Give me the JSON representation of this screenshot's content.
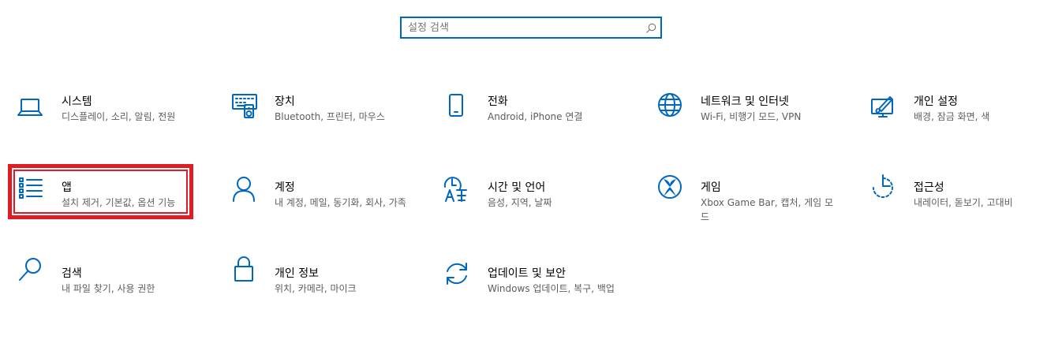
{
  "search": {
    "placeholder": "설정 검색"
  },
  "colors": {
    "accent": "#0067c0",
    "highlight_border": "#e01b24",
    "description": "#5d5d5d"
  },
  "tiles": [
    {
      "title": "시스템",
      "desc": "디스플레이, 소리, 알림, 전원",
      "icon": "laptop-icon"
    },
    {
      "title": "장치",
      "desc": "Bluetooth, 프린터, 마우스",
      "icon": "keyboard-speaker-icon"
    },
    {
      "title": "전화",
      "desc": "Android, iPhone 연결",
      "icon": "phone-icon"
    },
    {
      "title": "네트워크 및 인터넷",
      "desc": "Wi-Fi, 비행기 모드, VPN",
      "icon": "globe-icon"
    },
    {
      "title": "개인 설정",
      "desc": "배경, 잠금 화면, 색",
      "icon": "paint-monitor-icon"
    },
    {
      "title": "앱",
      "desc": "설치 제거, 기본값, 옵션 기능",
      "icon": "apps-list-icon"
    },
    {
      "title": "계정",
      "desc": "내 계정, 메일, 동기화, 회사, 가족",
      "icon": "person-icon"
    },
    {
      "title": "시간 및 언어",
      "desc": "음성, 지역, 날짜",
      "icon": "time-language-icon"
    },
    {
      "title": "게임",
      "desc": "Xbox Game Bar, 캡처, 게임 모드",
      "icon": "xbox-icon"
    },
    {
      "title": "접근성",
      "desc": "내레이터, 돋보기, 고대비",
      "icon": "accessibility-timer-icon"
    },
    {
      "title": "검색",
      "desc": "내 파일 찾기, 사용 권한",
      "icon": "search-magnifier-icon"
    },
    {
      "title": "개인 정보",
      "desc": "위치, 카메라, 마이크",
      "icon": "lock-icon"
    },
    {
      "title": "업데이트 및 보안",
      "desc": "Windows 업데이트, 복구, 백업",
      "icon": "sync-arrows-icon"
    }
  ],
  "selected_tile": "앱"
}
